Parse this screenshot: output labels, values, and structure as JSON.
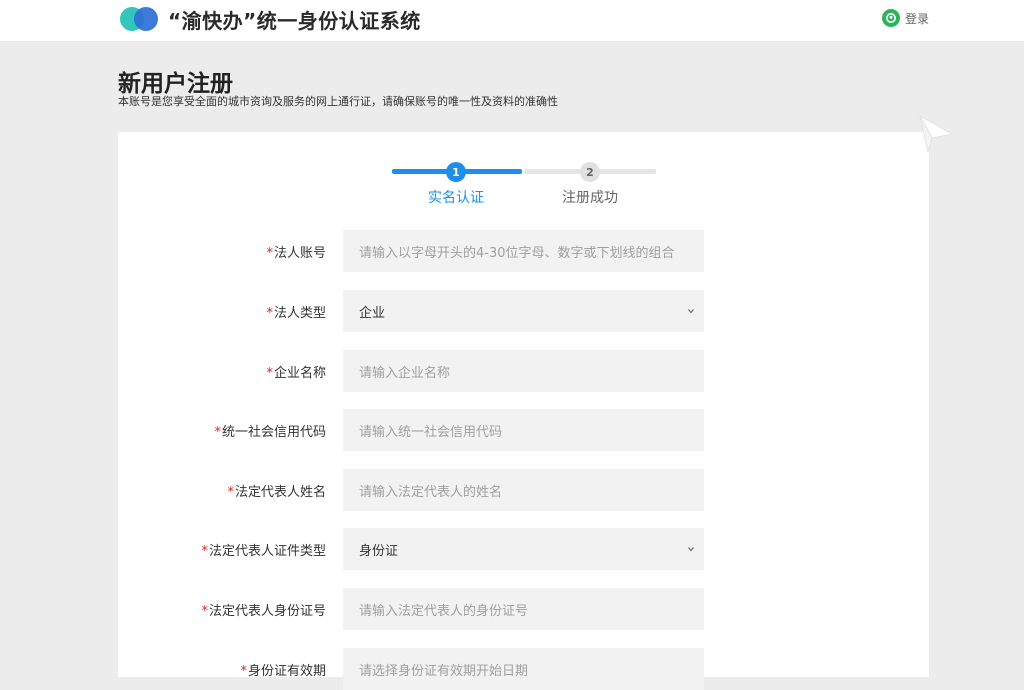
{
  "header": {
    "title": "“渝快办”统一身份认证系统",
    "login_label": "登录"
  },
  "page": {
    "title": "新用户注册",
    "subtitle": "本账号是您享受全面的城市资询及服务的网上通行证，请确保账号的唯一性及资料的准确性"
  },
  "steps": [
    {
      "number": "1",
      "label": "实名认证",
      "active": true
    },
    {
      "number": "2",
      "label": "注册成功",
      "active": false
    }
  ],
  "form": {
    "required_mark": "*",
    "fields": [
      {
        "label": "法人账号",
        "type": "input",
        "value": "",
        "placeholder": "请输入以字母开头的4-30位字母、数字或下划线的组合"
      },
      {
        "label": "法人类型",
        "type": "select",
        "value": "企业",
        "placeholder": ""
      },
      {
        "label": "企业名称",
        "type": "input",
        "value": "",
        "placeholder": "请输入企业名称"
      },
      {
        "label": "统一社会信用代码",
        "type": "input",
        "value": "",
        "placeholder": "请输入统一社会信用代码"
      },
      {
        "label": "法定代表人姓名",
        "type": "input",
        "value": "",
        "placeholder": "请输入法定代表人的姓名"
      },
      {
        "label": "法定代表人证件类型",
        "type": "select",
        "value": "身份证",
        "placeholder": ""
      },
      {
        "label": "法定代表人身份证号",
        "type": "input",
        "value": "",
        "placeholder": "请输入法定代表人的身份证号"
      },
      {
        "label": "身份证有效期",
        "type": "input",
        "value": "",
        "placeholder": "请选择身份证有效期开始日期"
      }
    ]
  },
  "colors": {
    "accent": "#1e8ee8",
    "required": "#e02020",
    "login_icon": "#2db45a",
    "logo_teal": "#33c6bd",
    "logo_blue": "#2d6fd6"
  },
  "icons": {
    "logo": "logo-icon",
    "login": "user-icon",
    "select": "chevron-down-icon",
    "decoration": "paper-plane-icon"
  }
}
